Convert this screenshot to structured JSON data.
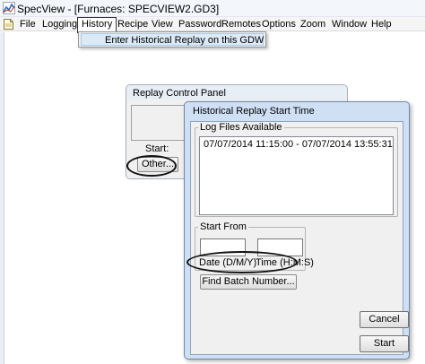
{
  "window": {
    "title": "SpecView - [Furnaces: SPECVIEW2.GD3]"
  },
  "menubar": {
    "items": [
      {
        "label": "File"
      },
      {
        "label": "Logging"
      },
      {
        "label": "History",
        "active": true
      },
      {
        "label": "Recipe"
      },
      {
        "label": "View"
      },
      {
        "label": "Password"
      },
      {
        "label": "Remotes"
      },
      {
        "label": "Options"
      },
      {
        "label": "Zoom"
      },
      {
        "label": "Window"
      },
      {
        "label": "Help"
      }
    ]
  },
  "history_menu": {
    "items": [
      {
        "label": "Enter Historical Replay on this GDW",
        "highlighted": true
      }
    ]
  },
  "replay_control_panel": {
    "title": "Replay Control Panel",
    "start_label": "Start:",
    "other_button": "Other..."
  },
  "historical_replay_dialog": {
    "title": "Historical Replay Start Time",
    "log_files_label": "Log Files Available",
    "log_files": [
      "07/07/2014  11:15:00 - 07/07/2014  13:55:31"
    ],
    "start_from_label": "Start From",
    "date_value": "",
    "time_value": "",
    "date_label": "Date (D/M/Y)",
    "time_label": "Time (H:M:S)",
    "find_batch_button": "Find Batch Number...",
    "cancel_button": "Cancel",
    "start_button": "Start"
  },
  "icons": {
    "app": "specview-app-icon",
    "document": "document-icon"
  },
  "colors": {
    "dialog_frame": "#cfe0f4",
    "client_bg": "#f0f0f0",
    "menu_highlight": "#dceaf7"
  }
}
